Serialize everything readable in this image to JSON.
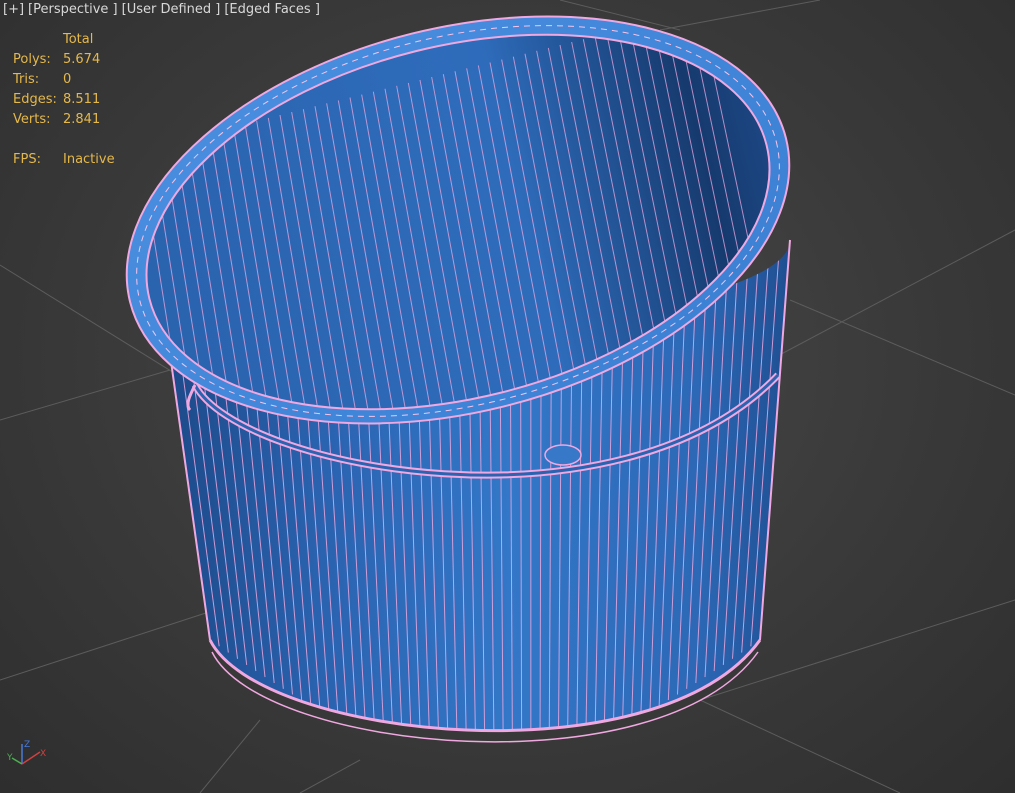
{
  "viewport": {
    "menu": {
      "plus": "[+]",
      "view": "[Perspective ]",
      "shading_style": "[User Defined ]",
      "edged": "[Edged Faces ]"
    },
    "stats": {
      "header": "Total",
      "polys_label": "Polys:",
      "polys_value": "5.674",
      "tris_label": "Tris:",
      "tris_value": "0",
      "edges_label": "Edges:",
      "edges_value": "8.511",
      "verts_label": "Verts:",
      "verts_value": "2.841",
      "fps_label": "FPS:",
      "fps_value": "Inactive"
    },
    "axis": {
      "x": "X",
      "y": "Y",
      "z": "Z"
    },
    "colors": {
      "background": "#3a3a3a",
      "grid": "#5a5a5a",
      "stats_text": "#e5b84a",
      "mesh_fill": "#2e6fc0",
      "wire": "#f0a8e0",
      "axis_x": "#d24040",
      "axis_y": "#4caf50",
      "axis_z": "#4a7ad8"
    },
    "object": "bucket-mesh"
  }
}
